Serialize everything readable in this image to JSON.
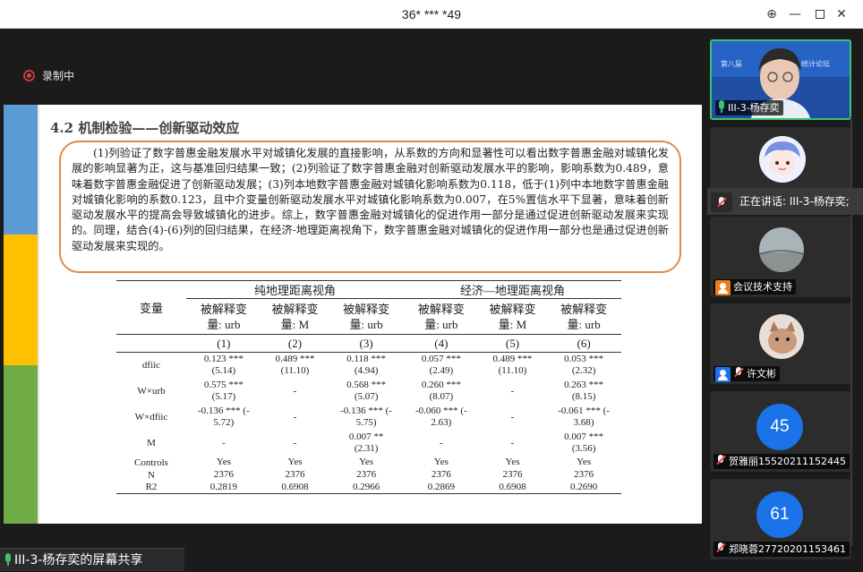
{
  "window": {
    "title": "36* *** *49",
    "buttons": {
      "pin": "⊕",
      "minimize": "—",
      "maximize": "□",
      "close": "✕"
    }
  },
  "recording": {
    "label": "录制中"
  },
  "slide": {
    "heading": "4.2 机制检验——创新驱动效应",
    "paragraph": "(1)列验证了数字普惠金融发展水平对城镇化发展的直接影响，从系数的方向和显著性可以看出数字普惠金融对城镇化发展的影响显著为正，这与基准回归结果一致；(2)列验证了数字普惠金融对创新驱动发展水平的影响，影响系数为0.489，意味着数字普惠金融促进了创新驱动发展；(3)列本地数字普惠金融对城镇化影响系数为0.118，低于(1)列中本地数字普惠金融对城镇化影响的系数0.123，且中介变量创新驱动发展水平对城镇化影响系数为0.007，在5%置信水平下显著，意味着创新驱动发展水平的提高会导致城镇化的进步。综上，数字普惠金融对城镇化的促进作用一部分是通过促进创新驱动发展来实现的。同理，结合(4)-(6)列的回归结果，在经济-地理距离视角下，数字普惠金融对城镇化的促进作用一部分也是通过促进创新驱动发展来实现的。",
    "table": {
      "var_header": "变量",
      "groups": [
        "纯地理距离视角",
        "经济—地理距离视角"
      ],
      "col_headers": [
        [
          "被解释变",
          "量: urb"
        ],
        [
          "被解释变",
          "量: M"
        ],
        [
          "被解释变",
          "量: urb"
        ],
        [
          "被解释变",
          "量: urb"
        ],
        [
          "被解释变",
          "量: M"
        ],
        [
          "被解释变",
          "量: urb"
        ]
      ],
      "col_index": [
        "(1)",
        "(2)",
        "(3)",
        "(4)",
        "(5)",
        "(6)"
      ],
      "rows": [
        {
          "var": "dfiic",
          "cells": [
            [
              "0.123 ***",
              "(5.14)"
            ],
            [
              "0.489 ***",
              "(11.10)"
            ],
            [
              "0.118 ***",
              "(4.94)"
            ],
            [
              "0.057 ***",
              "(2.49)"
            ],
            [
              "0.489 ***",
              "(11.10)"
            ],
            [
              "0.053 ***",
              "(2.32)"
            ]
          ]
        },
        {
          "var": "W×urb",
          "cells": [
            [
              "0.575 ***",
              "(5.17)"
            ],
            [
              "-",
              ""
            ],
            [
              "0.568 ***",
              "(5.07)"
            ],
            [
              "0.260 ***",
              "(8.07)"
            ],
            [
              "-",
              ""
            ],
            [
              "0.263 ***",
              "(8.15)"
            ]
          ]
        },
        {
          "var": "W×dfiic",
          "cells": [
            [
              "-0.136 *** (-",
              "5.72)"
            ],
            [
              "-",
              ""
            ],
            [
              "-0.136 *** (-",
              "5.75)"
            ],
            [
              "-0.060 *** (-",
              "2.63)"
            ],
            [
              "-",
              ""
            ],
            [
              "-0.061 *** (-",
              "3.68)"
            ]
          ]
        },
        {
          "var": "M",
          "cells": [
            [
              "-",
              ""
            ],
            [
              "-",
              ""
            ],
            [
              "0.007 **",
              "(2.31)"
            ],
            [
              "-",
              ""
            ],
            [
              "-",
              ""
            ],
            [
              "0.007 ***",
              "(3.56)"
            ]
          ]
        },
        {
          "var": "Controls",
          "cells": [
            [
              "Yes",
              ""
            ],
            [
              "Yes",
              ""
            ],
            [
              "Yes",
              ""
            ],
            [
              "Yes",
              ""
            ],
            [
              "Yes",
              ""
            ],
            [
              "Yes",
              ""
            ]
          ]
        },
        {
          "var": "N",
          "cells": [
            [
              "2376",
              ""
            ],
            [
              "2376",
              ""
            ],
            [
              "2376",
              ""
            ],
            [
              "2376",
              ""
            ],
            [
              "2376",
              ""
            ],
            [
              "2376",
              ""
            ]
          ]
        },
        {
          "var": "R2",
          "cells": [
            [
              "0.2819",
              ""
            ],
            [
              "0.6908",
              ""
            ],
            [
              "0.2966",
              ""
            ],
            [
              "0.2869",
              ""
            ],
            [
              "0.6908",
              ""
            ],
            [
              "0.2690",
              ""
            ]
          ]
        }
      ]
    }
  },
  "share_label": "III-3-杨存奕的屏幕共享",
  "participants": {
    "p1_name": "III-3-杨存奕",
    "speaking_text": "正在讲话: III-3-杨存奕;",
    "p3_name": "会议技术支持",
    "p4_name": "许文彬",
    "p5_avatar": "45",
    "p5_name": "贺雅丽15520211152445",
    "p6_avatar": "61",
    "p6_name": "郑晓蓉27720201153461",
    "avatar_color": "#1a73e8"
  }
}
